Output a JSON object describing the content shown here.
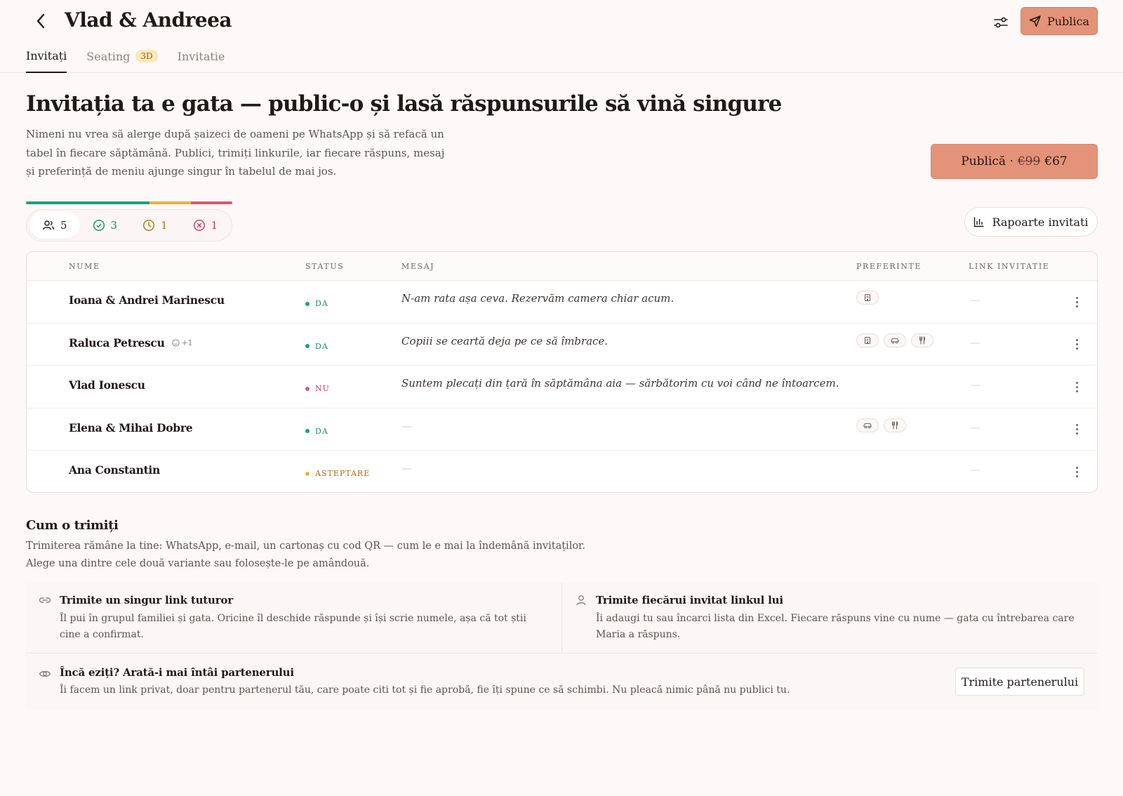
{
  "header": {
    "title": "Vlad & Andreea",
    "publish_label": "Publica",
    "tabs": [
      {
        "label": "Invitați",
        "active": true
      },
      {
        "label": "Seating",
        "badge": "3D"
      },
      {
        "label": "Invitatie"
      }
    ]
  },
  "hero": {
    "title": "Invitația ta e gata — public-o și lasă răspunsurile să vină singure",
    "description": "Nimeni nu vrea să alerge după șaizeci de oameni pe WhatsApp și să refacă un tabel în fiecare săptămână. Publici, trimiți linkurile, iar fiecare răspuns, mesaj și preferință de meniu ajunge singur în tabelul de mai jos.",
    "publish_label": "Publică ·",
    "old_price": "€99",
    "new_price": "€67"
  },
  "stats": {
    "total": "5",
    "confirmed": "3",
    "pending": "1",
    "declined": "1",
    "progress": {
      "confirmed": 0.6,
      "pending": 0.2,
      "declined": 0.2
    }
  },
  "reports_label": "Rapoarte invitati",
  "table": {
    "headers": {
      "name": "NUME",
      "status": "STATUS",
      "message": "MESAJ",
      "preferences": "PREFERINTE",
      "link": "LINK INVITATIE"
    },
    "rows": [
      {
        "name": "Ioana & Andrei Marinescu",
        "plus": "",
        "status": "DA",
        "status_type": "yes",
        "message": "N-am rata așa ceva. Rezervăm camera chiar acum.",
        "prefs": [
          "hotel-icon"
        ],
        "link": "—"
      },
      {
        "name": "Raluca Petrescu",
        "plus": "+1",
        "status": "DA",
        "status_type": "yes",
        "message": "Copiii se ceartă deja pe ce să îmbrace.",
        "prefs": [
          "hotel-icon",
          "car-icon",
          "utensils-icon"
        ],
        "link": "—"
      },
      {
        "name": "Vlad Ionescu",
        "plus": "",
        "status": "NU",
        "status_type": "no",
        "message": "Suntem plecați din țară în săptămâna aia — sărbătorim cu voi când ne întoarcem.",
        "prefs": [],
        "link": "—"
      },
      {
        "name": "Elena & Mihai Dobre",
        "plus": "",
        "status": "DA",
        "status_type": "yes",
        "message": "—",
        "prefs": [
          "car-icon",
          "utensils-icon"
        ],
        "link": "—"
      },
      {
        "name": "Ana Constantin",
        "plus": "",
        "status": "ASTEPTARE",
        "status_type": "pending",
        "message": "—",
        "prefs": [],
        "link": "—"
      }
    ]
  },
  "send": {
    "title": "Cum o trimiți",
    "description": "Trimiterea rămâne la tine: WhatsApp, e-mail, un cartonaș cu cod QR — cum le e mai la îndemână invitaților. Alege una dintre cele două variante sau folosește-le pe amândouă.",
    "option_link": {
      "title": "Trimite un singur link tuturor",
      "description": "Îl pui în grupul familiei și gata. Oricine îl deschide răspunde și își scrie numele, așa că tot știi cine a confirmat."
    },
    "option_each": {
      "title": "Trimite fiecărui invitat linkul lui",
      "description": "Îi adaugi tu sau încarci lista din Excel. Fiecare răspuns vine cu nume — gata cu întrebarea care Maria a răspuns."
    },
    "partner": {
      "title": "Încă eziți? Arată-i mai întâi partenerului",
      "description": "Îi facem un link privat, doar pentru partenerul tău, care poate citi tot și fie aprobă, fie îți spune ce să schimbi. Nu pleacă nimic până nu publici tu.",
      "button": "Trimite partenerului"
    }
  },
  "colors": {
    "accent": "#e3937a",
    "yes": "#1aa37a",
    "pending": "#e8b53a",
    "no": "#e0566f"
  }
}
